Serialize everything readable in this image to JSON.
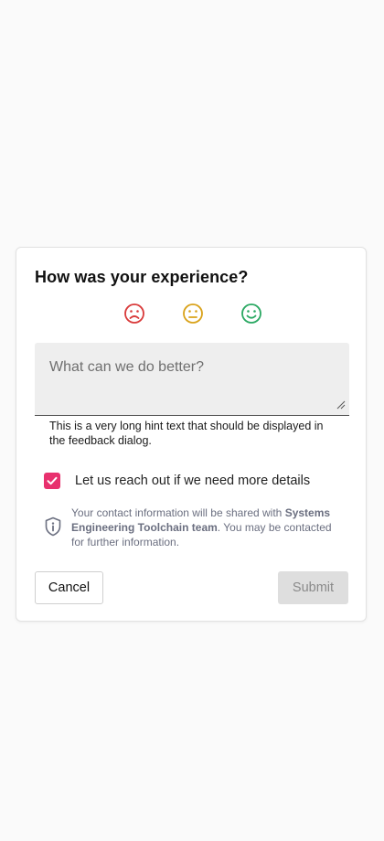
{
  "dialog": {
    "title": "How was your experience?",
    "ratings": [
      {
        "name": "sad",
        "icon": "sad-face-icon",
        "color": "#d93a3a"
      },
      {
        "name": "neutral",
        "icon": "neutral-face-icon",
        "color": "#d9a21a"
      },
      {
        "name": "happy",
        "icon": "happy-face-icon",
        "color": "#2aa862"
      }
    ],
    "feedback": {
      "placeholder": "What can we do better?",
      "value": "",
      "hint": "This is a very long hint text that should be displayed in the feedback dialog."
    },
    "contact_checkbox": {
      "checked": true,
      "label": "Let us reach out if we need more details",
      "color": "#e8316e"
    },
    "info": {
      "icon": "shield-info-icon",
      "prefix": "Your contact information will be shared with ",
      "team": "Systems Engineering Toolchain team",
      "suffix": ". You may be contacted for further information."
    },
    "buttons": {
      "cancel": "Cancel",
      "submit": "Submit",
      "submit_disabled": true
    }
  }
}
